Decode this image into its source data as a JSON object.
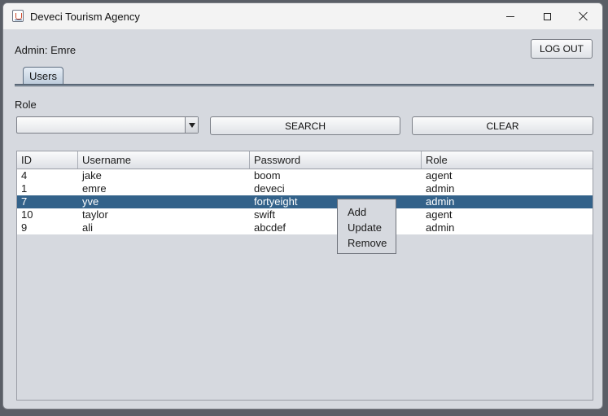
{
  "window": {
    "title": "Deveci Tourism Agency"
  },
  "header": {
    "admin_label": "Admin: Emre",
    "logout_label": "LOG OUT"
  },
  "tabs": [
    {
      "label": "Users"
    }
  ],
  "filter": {
    "role_label": "Role",
    "role_selected": "",
    "search_label": "SEARCH",
    "clear_label": "CLEAR"
  },
  "table": {
    "columns": [
      "ID",
      "Username",
      "Password",
      "Role"
    ],
    "rows": [
      [
        "4",
        "jake",
        "boom",
        "agent"
      ],
      [
        "1",
        "emre",
        "deveci",
        "admin"
      ],
      [
        "7",
        "yve",
        "fortyeight",
        "admin"
      ],
      [
        "10",
        "taylor",
        "swift",
        "agent"
      ],
      [
        "9",
        "ali",
        "abcdef",
        "admin"
      ]
    ],
    "selected_row": 2,
    "selection_color": "#33628a"
  },
  "context_menu": {
    "items": [
      "Add",
      "Update",
      "Remove"
    ]
  },
  "icons": {
    "app": "java-app-icon",
    "minimize": "minimize-icon",
    "maximize": "maximize-icon",
    "close": "close-icon",
    "dropdown": "chevron-down-icon"
  }
}
